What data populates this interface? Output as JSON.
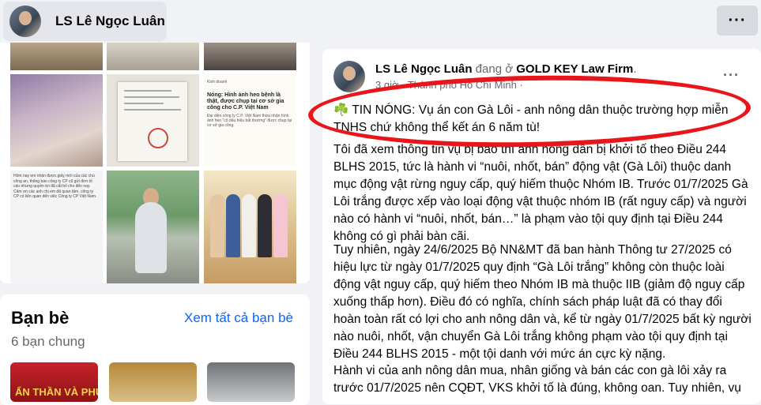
{
  "top_bar": {
    "profile_name": "LS Lê Ngọc Luân",
    "more_label": "···"
  },
  "photos": {
    "doc_headline": "Nóng: Hình ảnh heo bệnh là thật, được chụp tại cơ sở gia công cho C.P. Việt Nam",
    "doc_source": "Kinh doanh",
    "doc_caption": "Đại diện công ty C.P. Việt Nam thừa nhận hình ảnh heo \"có dấu hiệu bất thường\" được chụp tại cơ sở gia công.",
    "text_post": "Hôm nay em nhận được giấy mời của các chú công an, thông báo công ty CP cũ gửi đơn tố cáo nhưng quyền lợi đã cắt bỏ cho đến nay. Cảm ơn các anh chị em đã quan tâm, công ty CP có liên quan đến việc Công ty CP Việt Nam."
  },
  "friends": {
    "title": "Bạn bè",
    "see_all": "Xem tất cả bạn bè",
    "mutual": "6 bạn chung",
    "tile1_text": "ẤN THẦN VÀ PHỤNG"
  },
  "post": {
    "author": "LS Lê Ngọc Luân",
    "status_mid": " đang ở ",
    "location": "GOLD KEY Law Firm",
    "status_end": ".",
    "meta": "3 giờ · Thành phố Hồ Chí Minh ·",
    "more_label": "···",
    "clover": "☘️",
    "headline": " TIN NÓNG: Vụ án con Gà Lôi - anh nông dân thuộc trường hợp miễn TNHS chứ không thể kết án 6 năm tù!",
    "paragraph1": "Tôi đã xem thông tin vụ bị báo thì anh nông dân bị khởi tố theo Điều 244 BLHS 2015, tức là hành vi “nuôi, nhốt, bán” động vật (Gà Lôi) thuộc danh mục động vật rừng nguy cấp, quý hiếm thuộc Nhóm IB. Trước 01/7/2025 Gà Lôi trắng được xếp vào loại động vật thuộc nhóm IB (rất nguy cấp) và người nào có hành vi “nuôi, nhốt, bán…” là phạm vào tội quy định tại Điều 244 không có gì phải bàn cãi.",
    "paragraph2": "Tuy nhiên, ngày 24/6/2025 Bộ NN&MT đã ban hành Thông tư 27/2025 có hiệu lực từ ngày 01/7/2025 quy định “Gà Lôi trắng” không còn thuộc loài động vật nguy cấp, quý hiếm theo Nhóm IB mà thuộc IIB (giảm độ nguy cấp xuống thấp hơn). Điều đó có nghĩa, chính sách pháp luật đã có thay đổi hoàn toàn rất có lợi cho anh nông dân và, kể từ ngày 01/7/2025 bất kỳ người nào nuôi, nhốt, vận chuyển Gà Lôi trắng không phạm vào tội quy định tại Điều 244 BLHS 2015 - một tội danh với mức án cực kỳ nặng.",
    "paragraph3": "Hành vi của anh nông dân mua, nhân giống và bán các con gà lôi xảy ra trước 01/7/2025 nên CQĐT, VKS khởi tố là đúng, không oan. Tuy nhiên, vụ"
  },
  "colors": {
    "accent": "#0866ff",
    "highlight_ellipse": "#e8151b",
    "background": "#f0f2f5"
  }
}
